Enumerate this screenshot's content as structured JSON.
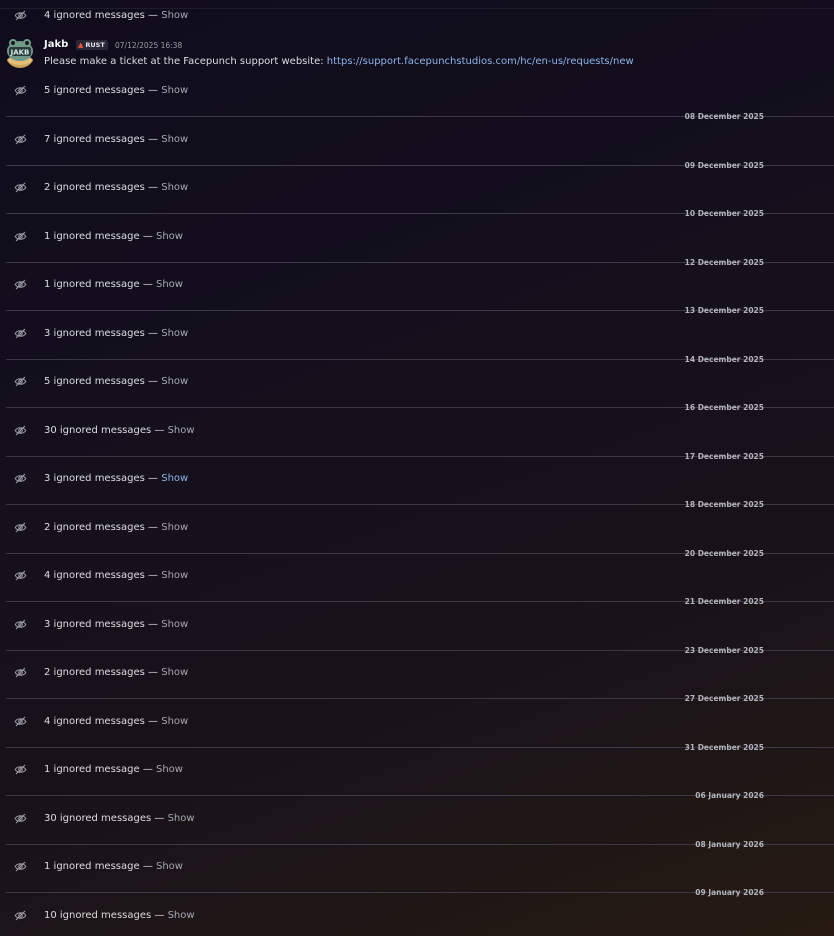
{
  "top_ignored": {
    "count_text": "4 ignored messages",
    "separator": " — ",
    "show_label": "Show"
  },
  "message": {
    "username": "Jakb",
    "avatar_text": "JAKB",
    "tag_icon": "fire-icon",
    "tag_label": "RUST",
    "timestamp": "07/12/2025 16:38",
    "text": "Please make a ticket at the Facepunch support website: ",
    "link": "https://support.facepunchstudios.com/hc/en-us/requests/new"
  },
  "separator": " — ",
  "show_label": "Show",
  "colors": {
    "link": "#8fb4e8",
    "background_top": "#0f0c1c",
    "background_bottom": "#261a12"
  },
  "groups": [
    {
      "count_text": "5 ignored messages",
      "date": "08 December 2025"
    },
    {
      "count_text": "7 ignored messages",
      "date": "09 December 2025"
    },
    {
      "count_text": "2 ignored messages",
      "date": "10 December 2025"
    },
    {
      "count_text": "1 ignored message",
      "date": "12 December 2025"
    },
    {
      "count_text": "1 ignored message",
      "date": "13 December 2025"
    },
    {
      "count_text": "3 ignored messages",
      "date": "14 December 2025"
    },
    {
      "count_text": "5 ignored messages",
      "date": "16 December 2025"
    },
    {
      "count_text": "30 ignored messages",
      "date": "17 December 2025"
    },
    {
      "count_text": "3 ignored messages",
      "date": "18 December 2025",
      "hovered": true
    },
    {
      "count_text": "2 ignored messages",
      "date": "20 December 2025"
    },
    {
      "count_text": "4 ignored messages",
      "date": "21 December 2025"
    },
    {
      "count_text": "3 ignored messages",
      "date": "23 December 2025"
    },
    {
      "count_text": "2 ignored messages",
      "date": "27 December 2025"
    },
    {
      "count_text": "4 ignored messages",
      "date": "31 December 2025"
    },
    {
      "count_text": "1 ignored message",
      "date": "06 January 2026"
    },
    {
      "count_text": "30 ignored messages",
      "date": "08 January 2026"
    },
    {
      "count_text": "1 ignored message",
      "date": "09 January 2026"
    },
    {
      "count_text": "10 ignored messages"
    }
  ]
}
